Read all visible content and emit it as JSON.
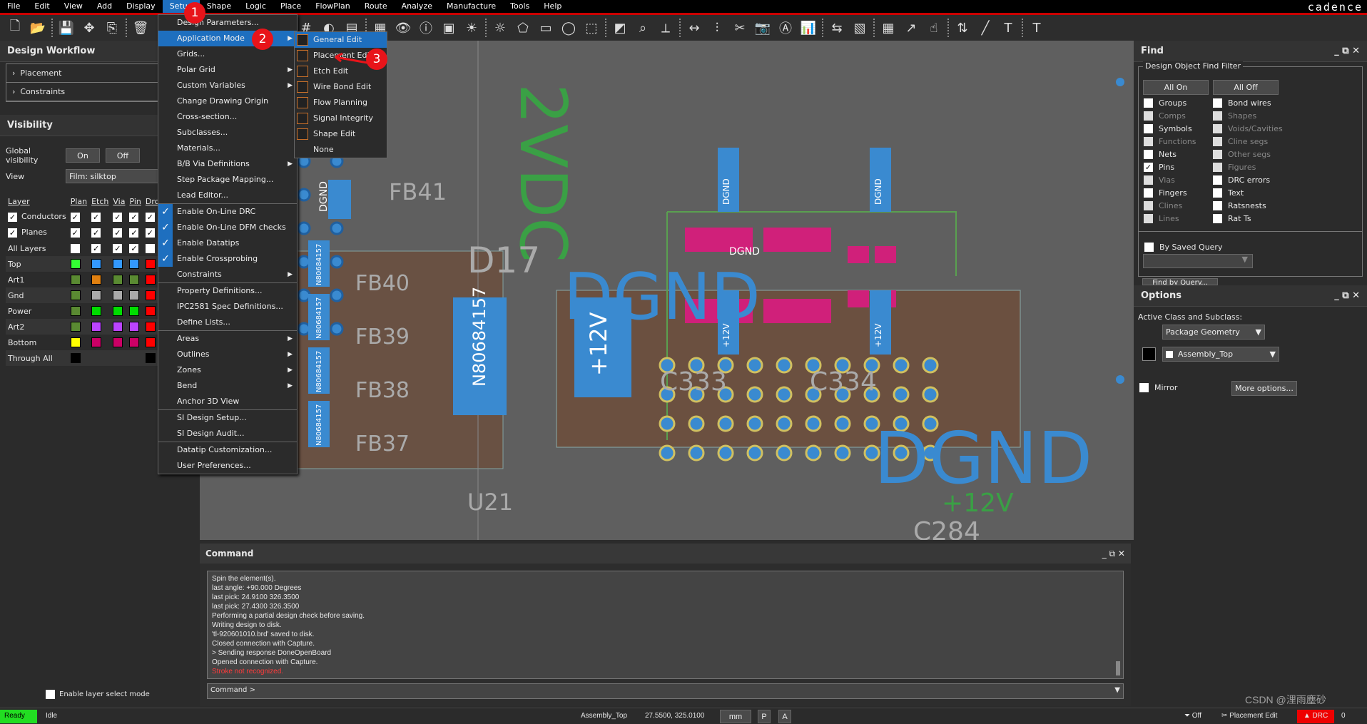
{
  "menubar": {
    "items": [
      "File",
      "Edit",
      "View",
      "Add",
      "Display",
      "Setup",
      "Shape",
      "Logic",
      "Place",
      "FlowPlan",
      "Route",
      "Analyze",
      "Manufacture",
      "Tools",
      "Help"
    ],
    "brand": "cadence"
  },
  "toolbar": {
    "icons": [
      "new-file",
      "open-folder",
      "save",
      "move",
      "copy",
      "delete",
      "undo",
      "zoom-fit",
      "zoom-in",
      "zoom-out",
      "zoom-previous",
      "redraw",
      "grid",
      "color",
      "layers",
      "shade",
      "view",
      "info",
      "3d-view",
      "highlight",
      "dehighlight",
      "add-shape",
      "add-rect",
      "add-circle",
      "select-shape",
      "void",
      "etch",
      "route",
      "slide",
      "pins",
      "via",
      "snapshot",
      "rename",
      "report",
      "swap",
      "placement",
      "connect",
      "touch",
      "flip",
      "add-line",
      "add-text",
      "edit-text",
      "share"
    ]
  },
  "left": {
    "workflow": {
      "title": "Design Workflow",
      "items": [
        "Placement",
        "Constraints"
      ]
    },
    "visibility": {
      "title": "Visibility",
      "global_label": "Global visibility",
      "on": "On",
      "off": "Off",
      "view_label": "View",
      "view_value": "Film: silktop",
      "columns": [
        "Layer",
        "Plan",
        "Etch",
        "Via",
        "Pin",
        "Drc"
      ],
      "groups": [
        {
          "name": "Conductors",
          "checks": [
            true,
            true,
            true,
            true,
            true,
            true
          ]
        },
        {
          "name": "Planes",
          "checks": [
            true,
            true,
            true,
            true,
            true,
            true
          ]
        }
      ],
      "all_layers": {
        "name": "All Layers",
        "checks": [
          false,
          true,
          true,
          true,
          false
        ]
      },
      "layers": [
        {
          "name": "Top",
          "colors": [
            "#33ff33",
            "#3399ff",
            "#3399ff",
            "#3399ff",
            "#ff0000"
          ]
        },
        {
          "name": "Art1",
          "colors": [
            "#5a8a32",
            "#e08010",
            "#5a8a32",
            "#5a8a32",
            "#ff0000"
          ]
        },
        {
          "name": "Gnd",
          "colors": [
            "#5a8a32",
            "#aaaaaa",
            "#aaaaaa",
            "#aaaaaa",
            "#ff0000"
          ]
        },
        {
          "name": "Power",
          "colors": [
            "#5a8a32",
            "#00dd00",
            "#00dd00",
            "#00dd00",
            "#ff0000"
          ]
        },
        {
          "name": "Art2",
          "colors": [
            "#5a8a32",
            "#bb44ff",
            "#bb44ff",
            "#bb44ff",
            "#ff0000"
          ]
        },
        {
          "name": "Bottom",
          "colors": [
            "#ffff00",
            "#cc0066",
            "#cc0066",
            "#cc0066",
            "#ff0000"
          ]
        },
        {
          "name": "Through All",
          "colors": [
            "#000000",
            "",
            "",
            "",
            "#000000"
          ]
        }
      ],
      "layer_select": "Enable layer select mode"
    }
  },
  "setup_menu": [
    {
      "label": "Design Parameters..."
    },
    {
      "label": "Application Mode",
      "submenu": true,
      "highlight": true
    },
    {
      "label": "Grids..."
    },
    {
      "label": "Polar Grid",
      "submenu": true
    },
    {
      "label": "Custom Variables",
      "submenu": true
    },
    {
      "label": "Change Drawing Origin"
    },
    {
      "label": "Cross-section..."
    },
    {
      "label": "Subclasses..."
    },
    {
      "label": "Materials..."
    },
    {
      "label": "B/B Via Definitions",
      "submenu": true
    },
    {
      "label": "Step Package Mapping..."
    },
    {
      "label": "Lead Editor..."
    },
    {
      "label": "Enable On-Line DRC",
      "checked": true,
      "sep": true
    },
    {
      "label": "Enable On-Line DFM checks",
      "checked": true
    },
    {
      "label": "Enable Datatips",
      "checked": true
    },
    {
      "label": "Enable Crossprobing",
      "checked": true
    },
    {
      "label": "Constraints",
      "submenu": true
    },
    {
      "label": "Property Definitions...",
      "sep": true
    },
    {
      "label": "IPC2581 Spec Definitions..."
    },
    {
      "label": "Define Lists..."
    },
    {
      "label": "Areas",
      "submenu": true,
      "sep": true
    },
    {
      "label": "Outlines",
      "submenu": true
    },
    {
      "label": "Zones",
      "submenu": true
    },
    {
      "label": "Bend",
      "submenu": true
    },
    {
      "label": "Anchor 3D View"
    },
    {
      "label": "SI Design Setup...",
      "sep": true
    },
    {
      "label": "SI Design Audit..."
    },
    {
      "label": "Datatip Customization...",
      "sep": true
    },
    {
      "label": "User Preferences..."
    }
  ],
  "app_mode_submenu": [
    {
      "label": "General Edit",
      "highlight": true
    },
    {
      "label": "Placement Edit"
    },
    {
      "label": "Etch Edit"
    },
    {
      "label": "Wire Bond Edit"
    },
    {
      "label": "Flow Planning"
    },
    {
      "label": "Signal Integrity"
    },
    {
      "label": "Shape Edit"
    },
    {
      "label": "None"
    }
  ],
  "annotations": [
    "1",
    "2",
    "3"
  ],
  "canvas": {
    "labels": [
      "2VDC",
      "FB41",
      "FB40",
      "FB39",
      "FB38",
      "FB37",
      "D17",
      "DGND",
      "+12V",
      "N80684157",
      "C333",
      "C334",
      "DGND",
      "+12V",
      "U21",
      "C284",
      "DGND",
      "DGND",
      "+12V",
      "+12V",
      "DGND",
      "DGND"
    ],
    "pad_text": "N80684157"
  },
  "find": {
    "title": "Find",
    "group": "Design Object Find Filter",
    "all_on": "All On",
    "all_off": "All Off",
    "items": [
      {
        "label": "Groups",
        "checked": false,
        "dim": false
      },
      {
        "label": "Bond wires",
        "checked": false,
        "dim": false
      },
      {
        "label": "Comps",
        "checked": false,
        "dim": true
      },
      {
        "label": "Shapes",
        "checked": false,
        "dim": true
      },
      {
        "label": "Symbols",
        "checked": false,
        "dim": false
      },
      {
        "label": "Voids/Cavities",
        "checked": false,
        "dim": true
      },
      {
        "label": "Functions",
        "checked": false,
        "dim": true
      },
      {
        "label": "Cline segs",
        "checked": false,
        "dim": true
      },
      {
        "label": "Nets",
        "checked": false,
        "dim": false
      },
      {
        "label": "Other segs",
        "checked": false,
        "dim": true
      },
      {
        "label": "Pins",
        "checked": true,
        "dim": false
      },
      {
        "label": "Figures",
        "checked": false,
        "dim": true
      },
      {
        "label": "Vias",
        "checked": false,
        "dim": true
      },
      {
        "label": "DRC errors",
        "checked": false,
        "dim": false
      },
      {
        "label": "Fingers",
        "checked": false,
        "dim": false
      },
      {
        "label": "Text",
        "checked": false,
        "dim": false
      },
      {
        "label": "Clines",
        "checked": false,
        "dim": true
      },
      {
        "label": "Ratsnests",
        "checked": false,
        "dim": false
      },
      {
        "label": "Lines",
        "checked": false,
        "dim": true
      },
      {
        "label": "Rat Ts",
        "checked": false,
        "dim": false
      }
    ],
    "saved_query": "By Saved Query",
    "find_by_query": "Find by Query..."
  },
  "options": {
    "title": "Options",
    "active_label": "Active Class and Subclass:",
    "class_value": "Package Geometry",
    "subclass_value": "Assembly_Top",
    "mirror": "Mirror",
    "more": "More options..."
  },
  "command": {
    "title": "Command",
    "log": [
      "Spin the element(s).",
      "last angle:  +90.000 Degrees",
      "last pick:  24.9100 326.3500",
      "last pick:  27.4300 326.3500",
      "Performing a partial design check before saving.",
      "Writing design to disk.",
      "'tl-920601010.brd' saved to disk.",
      "Closed connection with Capture.",
      "> Sending response DoneOpenBoard",
      "Opened connection with Capture."
    ],
    "error": "Stroke not recognized.",
    "prompt": "Command >"
  },
  "status": {
    "ready": "Ready",
    "idle": "Idle",
    "subclass": "Assembly_Top",
    "coords": "27.5500, 325.0100",
    "units": "mm",
    "p": "P",
    "a": "A",
    "filter": "Off",
    "mode": "Placement Edit",
    "drc": "DRC",
    "count": "0",
    "watermark": "CSDN @浬雨塵砂"
  },
  "colors": {
    "accent": "#1e6fbf",
    "ready": "#22dd22",
    "error": "#ff3b3b",
    "annotation": "#e8141a"
  }
}
